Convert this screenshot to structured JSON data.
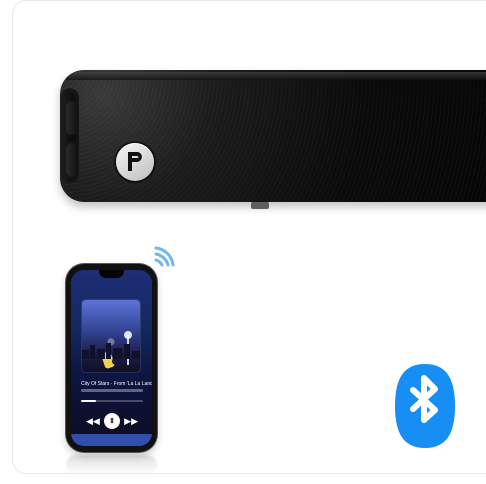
{
  "product": {
    "soundbar_logo": "P",
    "playback_progress_percent": 24
  },
  "icons": {
    "wireless_signal": "wifi-signal-icon",
    "bluetooth": "bluetooth-icon",
    "previous": "previous-track-icon",
    "pause": "pause-icon",
    "next": "next-track-icon"
  },
  "colors": {
    "bluetooth_blue": "#168ef4",
    "signal_blue": "#72b7ea",
    "phone_screen": "#1e2d76"
  },
  "phone": {
    "track_title": "City Of Stars · From 'La La Land'",
    "controls": {
      "previous": "◀◀",
      "pause": "Ⅱ",
      "next": "▶▶"
    }
  }
}
